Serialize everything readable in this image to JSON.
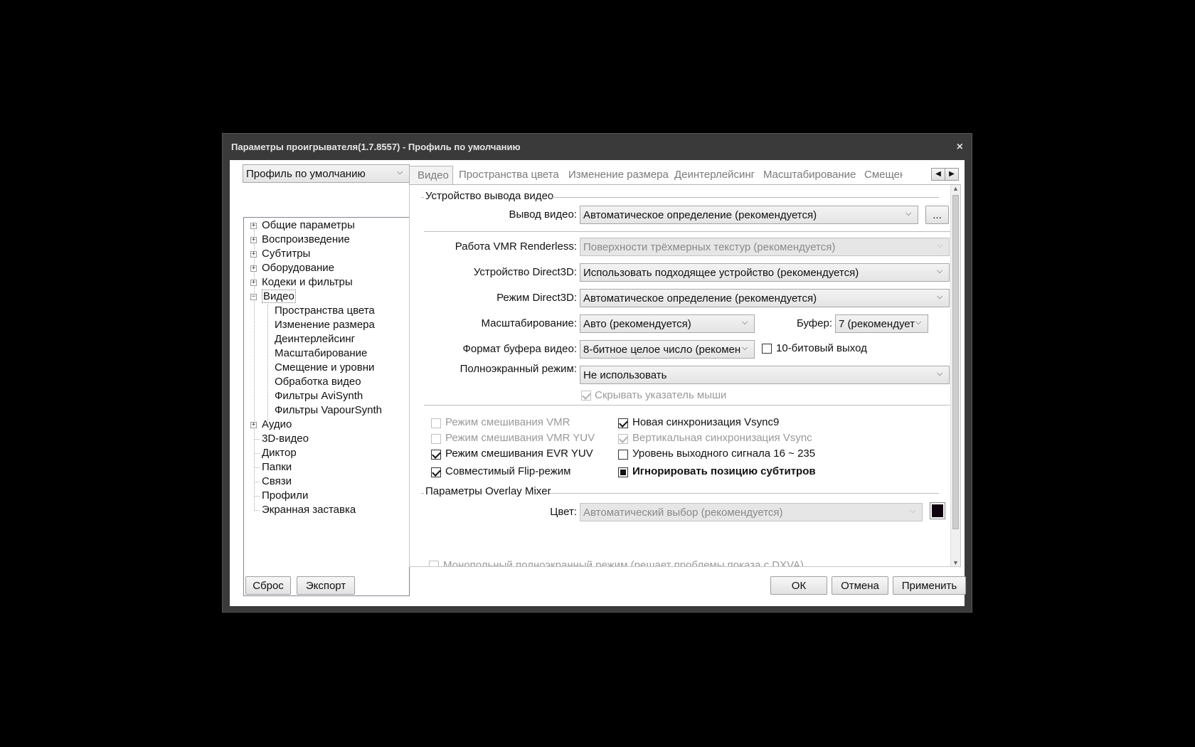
{
  "window": {
    "title": "Параметры проигрывателя(1.7.8557) - Профиль по умолчанию",
    "close_glyph": "×"
  },
  "profile_select": {
    "value": "Профиль по умолчанию"
  },
  "tree": {
    "items": [
      {
        "label": "Общие параметры",
        "expander": "+"
      },
      {
        "label": "Воспроизведение",
        "expander": "+"
      },
      {
        "label": "Субтитры",
        "expander": "+"
      },
      {
        "label": "Оборудование",
        "expander": "+"
      },
      {
        "label": "Кодеки и фильтры",
        "expander": "+"
      },
      {
        "label": "Видео",
        "expander": "−"
      },
      {
        "label": "Пространства цвета"
      },
      {
        "label": "Изменение размера"
      },
      {
        "label": "Деинтерлейсинг"
      },
      {
        "label": "Масштабирование"
      },
      {
        "label": "Смещение и уровни"
      },
      {
        "label": "Обработка видео"
      },
      {
        "label": "Фильтры AviSynth"
      },
      {
        "label": "Фильтры VapourSynth"
      },
      {
        "label": "Аудио",
        "expander": "+"
      },
      {
        "label": "3D-видео"
      },
      {
        "label": "Диктор"
      },
      {
        "label": "Папки"
      },
      {
        "label": "Связи"
      },
      {
        "label": "Профили"
      },
      {
        "label": "Экранная заставка"
      }
    ]
  },
  "tabs": [
    "Видео",
    "Пространства цвета",
    "Изменение размера",
    "Деинтерлейсинг",
    "Масштабирование",
    "Смещен"
  ],
  "tab_scroll": {
    "left": "◀",
    "right": "▶"
  },
  "video_output_group": {
    "title": "Устройство вывода видео",
    "output_label": "Вывод видео:",
    "output_value": "Автоматическое определение (рекомендуется)",
    "more_button": "...",
    "vmr_label": "Работа VMR Renderless:",
    "vmr_value": "Поверхности трёхмерных текстур (рекомендуется)",
    "d3d_device_label": "Устройство Direct3D:",
    "d3d_device_value": "Использовать подходящее устройство (рекомендуется)",
    "d3d_mode_label": "Режим Direct3D:",
    "d3d_mode_value": "Автоматическое определение (рекомендуется)",
    "scaling_label": "Масштабирование:",
    "scaling_value": "Авто (рекомендуется)",
    "buffer_label": "Буфер:",
    "buffer_value": "7 (рекомендует",
    "buffer_format_label": "Формат буфера видео:",
    "buffer_format_value": "8-битное целое число (рекомен",
    "ten_bit_label": "10-битовый выход",
    "fullscreen_label": "Полноэкранный режим:",
    "fullscreen_value": "Не использовать",
    "hide_cursor_label": "Скрывать указатель мыши"
  },
  "options": {
    "vmr_mixing": "Режим смешивания VMR",
    "vmr_yuv": "Режим смешивания VMR YUV",
    "evr_yuv": "Режим смешивания EVR YUV",
    "flip_mode": "Совместимый Flip-режим",
    "vsync9": "Новая синхронизация Vsync9",
    "vsync": "Вертикальная синхронизация Vsync",
    "levels": "Уровень выходного сигнала 16 ~ 235",
    "ignore_sub_pos": "Игнорировать позицию субтитров"
  },
  "overlay_group": {
    "title": "Параметры Overlay Mixer",
    "color_label": "Цвет:",
    "color_value": "Автоматический выбор (рекомендуется)",
    "swatch_color": "#100010"
  },
  "exclusive_label": "Монопольный полноэкранный режим (решает проблемы показа с DXVA)",
  "buttons": {
    "reset": "Сброс",
    "export": "Экспорт",
    "ok": "ОК",
    "cancel": "Отмена",
    "apply": "Применить"
  }
}
